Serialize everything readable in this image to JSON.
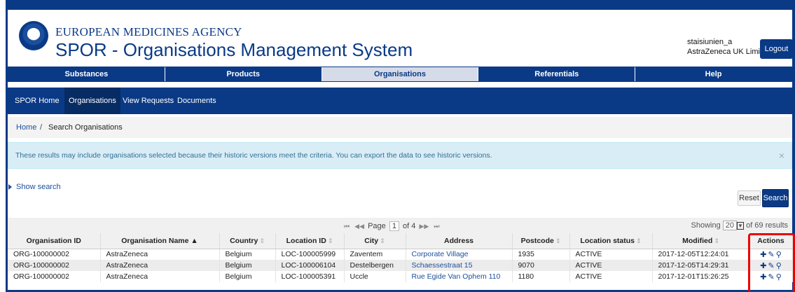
{
  "header": {
    "agency": "EUROPEAN MEDICINES AGENCY",
    "system_title": "SPOR - Organisations Management System",
    "user_name": "staisiunien_a",
    "user_org": "AstraZeneca UK Limited",
    "logout_label": "Logout"
  },
  "main_nav": {
    "items": [
      "Substances",
      "Products",
      "Organisations",
      "Referentials",
      "Help"
    ],
    "active": "Organisations"
  },
  "sub_nav": {
    "items": [
      "SPOR Home",
      "Organisations",
      "View Requests",
      "Documents"
    ],
    "active": "Organisations"
  },
  "breadcrumb": {
    "home": "Home",
    "separator": "/",
    "current": "Search Organisations"
  },
  "alert": {
    "text": "These results may include organisations selected because their historic versions meet the criteria. You can export the data to see historic versions.",
    "close": "×"
  },
  "search": {
    "show_search_label": "Show search",
    "reset_label": "Reset",
    "search_label": "Search"
  },
  "pager": {
    "first": "⏮",
    "prev": "◀◀",
    "page_label": "Page",
    "current_page": "1",
    "of_label": "of 4",
    "next": "▶▶",
    "last": "⏭"
  },
  "showing": {
    "prefix": "Showing",
    "page_size": "20",
    "suffix": "of 69 results"
  },
  "table": {
    "columns": [
      {
        "label": "Organisation ID",
        "sort": ""
      },
      {
        "label": "Organisation Name",
        "sort": "▲"
      },
      {
        "label": "Country",
        "sort": "⇕"
      },
      {
        "label": "Location ID",
        "sort": "⇕"
      },
      {
        "label": "City",
        "sort": "⇕"
      },
      {
        "label": "Address",
        "sort": ""
      },
      {
        "label": "Postcode",
        "sort": "⇕"
      },
      {
        "label": "Location status",
        "sort": "⇕"
      },
      {
        "label": "Modified",
        "sort": "⇕"
      },
      {
        "label": "Actions",
        "sort": ""
      }
    ],
    "rows": [
      {
        "org_id": "ORG-100000002",
        "org_name": "AstraZeneca",
        "country": "Belgium",
        "location_id": "LOC-100005999",
        "city": "Zaventem",
        "address": "Corporate Village",
        "postcode": "1935",
        "status": "ACTIVE",
        "modified": "2017-12-05T12:24:01"
      },
      {
        "org_id": "ORG-100000002",
        "org_name": "AstraZeneca",
        "country": "Belgium",
        "location_id": "LOC-100006104",
        "city": "Destelbergen",
        "address": "Schaessestraat 15",
        "postcode": "9070",
        "status": "ACTIVE",
        "modified": "2017-12-05T14:29:31"
      },
      {
        "org_id": "ORG-100000002",
        "org_name": "AstraZeneca",
        "country": "Belgium",
        "location_id": "LOC-100005391",
        "city": "Uccle",
        "address": "Rue Egide Van Ophem 110",
        "postcode": "1180",
        "status": "ACTIVE",
        "modified": "2017-12-01T15:26:25"
      }
    ],
    "actions_icons": [
      "plus-icon",
      "edit-icon",
      "view-icon"
    ]
  },
  "colors": {
    "brand": "#0a3a86",
    "link": "#1b4f9c",
    "alert_bg": "#d9edf7",
    "highlight": "#e00000"
  }
}
